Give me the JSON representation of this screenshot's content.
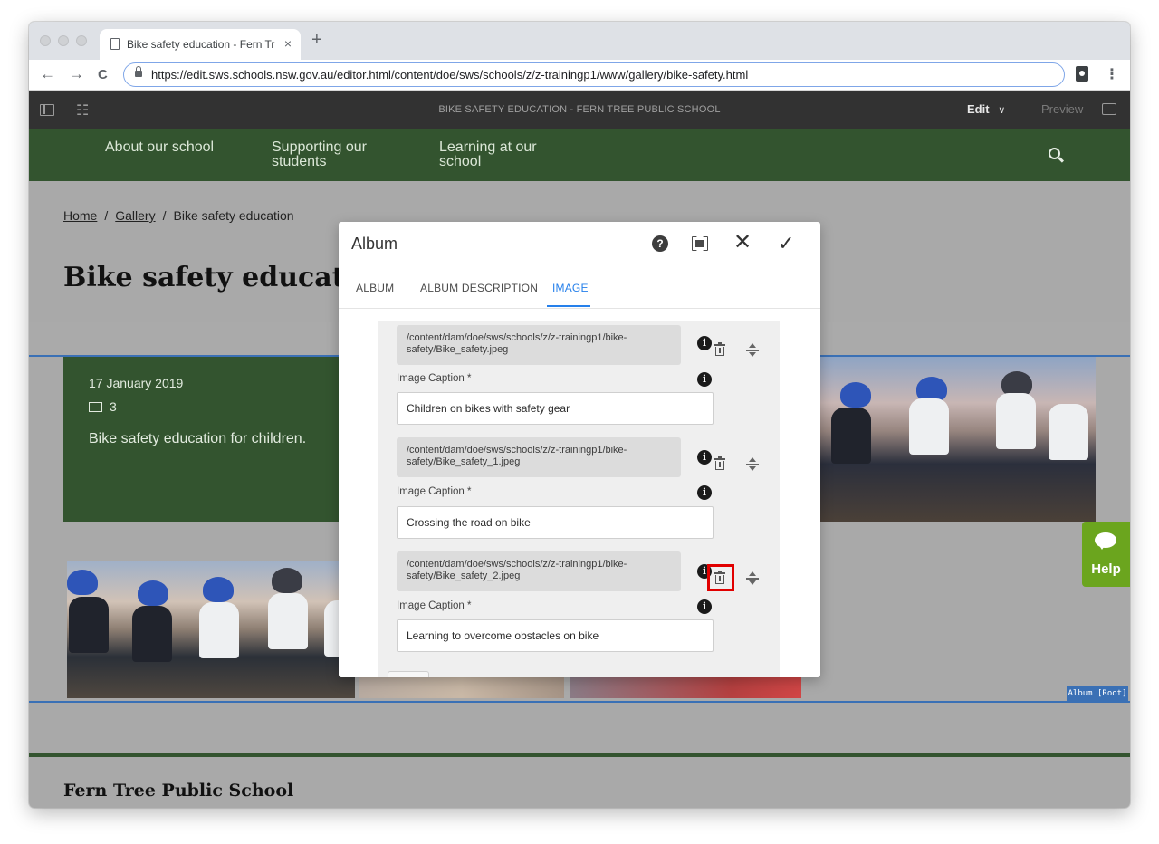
{
  "browser": {
    "tab_title": "Bike safety education - Fern Tr",
    "tab_close": "×",
    "new_tab": "+",
    "url": "https://edit.sws.schools.nsw.gov.au/editor.html/content/doe/sws/schools/z/z-trainingp1/www/gallery/bike-safety.html",
    "back": "←",
    "forward": "→",
    "reload": "C",
    "menu": "⋮"
  },
  "editor_bar": {
    "page_title": "BIKE SAFETY EDUCATION - FERN TREE PUBLIC SCHOOL",
    "edit_label": "Edit",
    "edit_chevron": "∨",
    "preview_label": "Preview",
    "properties_icon": "⚙"
  },
  "site_nav": {
    "items": [
      "About our school",
      "Supporting our",
      "students",
      "Learning at our",
      "school"
    ]
  },
  "breadcrumb": {
    "home": "Home",
    "sep": "/",
    "gallery": "Gallery",
    "current": "Bike safety education"
  },
  "page": {
    "title": "Bike safety education",
    "date": "17 January 2019",
    "image_count": "3",
    "description": "Bike safety education for children.",
    "album_root_label": "Album [Root]",
    "help_label": "Help",
    "footer_title": "Fern Tree Public School"
  },
  "dialog": {
    "title": "Album",
    "help_icon": "?",
    "close_icon": "✕",
    "done_icon": "✓",
    "tabs": [
      "ALBUM",
      "ALBUM DESCRIPTION",
      "IMAGE"
    ],
    "active_tab": "IMAGE",
    "info_glyph": "i",
    "items": [
      {
        "path_line1": "/content/dam/doe/sws/schools/z/z-trainingp1/bike-",
        "path_line2": "safety/Bike_safety.jpeg",
        "caption_label": "Image Caption *",
        "caption_value": "Children on bikes with safety gear"
      },
      {
        "path_line1": "/content/dam/doe/sws/schools/z/z-trainingp1/bike-",
        "path_line2": "safety/Bike_safety_1.jpeg",
        "caption_label": "Image Caption *",
        "caption_value": "Crossing the road on bike"
      },
      {
        "path_line1": "/content/dam/doe/sws/schools/z/z-trainingp1/bike-",
        "path_line2": "safety/Bike_safety_2.jpeg",
        "caption_label": "Image Caption *",
        "caption_value": "Learning to overcome obstacles on bike"
      }
    ]
  },
  "colors": {
    "site_green": "#33542f",
    "accent_blue": "#2680eb",
    "help_green": "#6ba51e",
    "highlight_red": "#e10000"
  }
}
